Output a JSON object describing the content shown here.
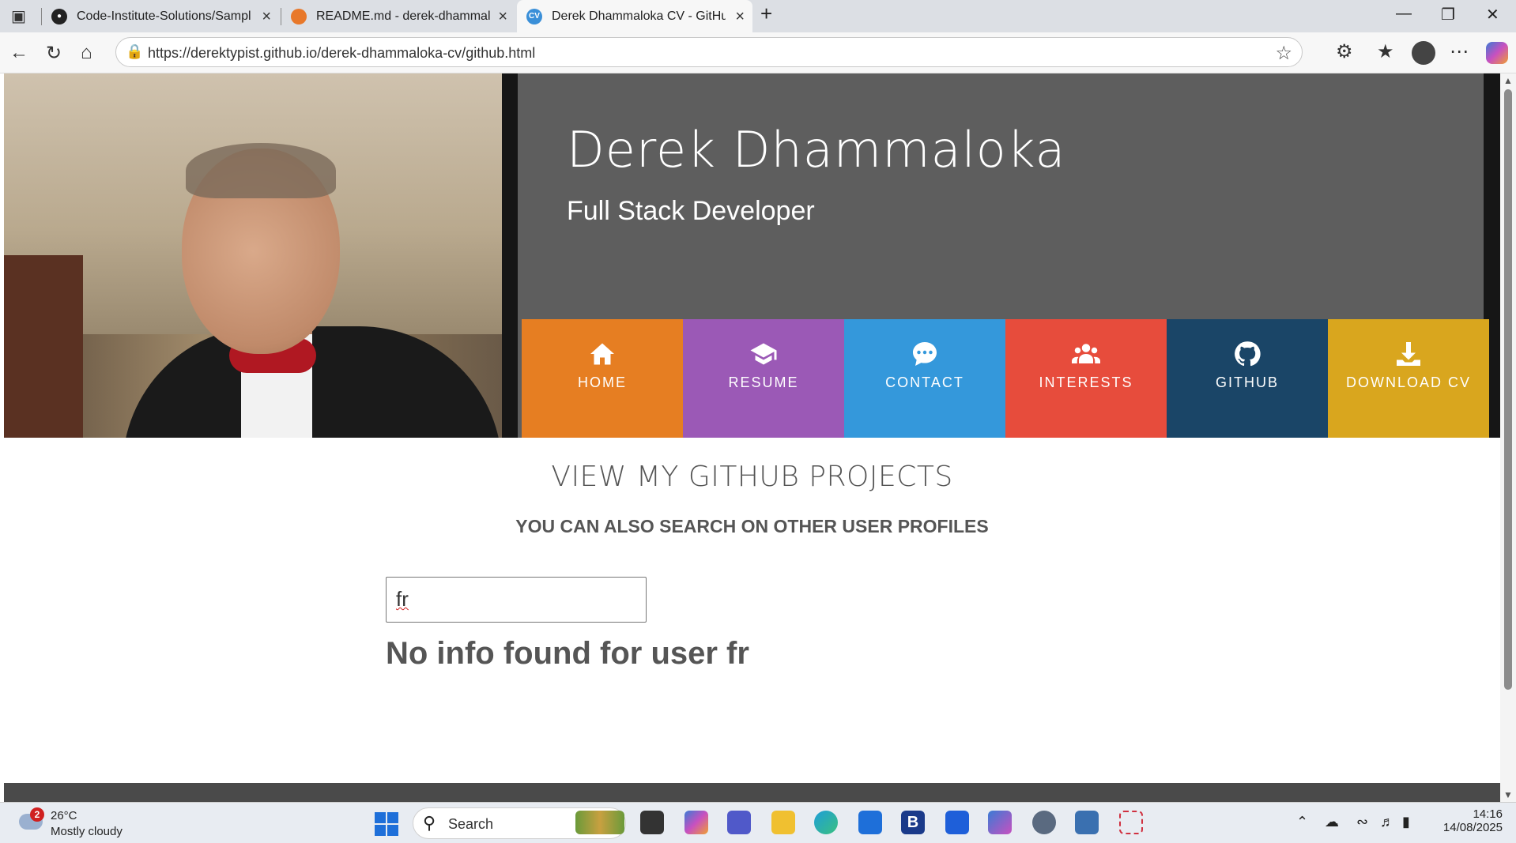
{
  "browser": {
    "tabs": [
      {
        "title": "Code-Institute-Solutions/Sample",
        "active": false
      },
      {
        "title": "README.md - derek-dhammalok",
        "active": false
      },
      {
        "title": "Derek Dhammaloka CV - GitHub",
        "active": true
      }
    ],
    "active_tab_favicon": "CV",
    "url": "https://derektypist.github.io/derek-dhammaloka-cv/github.html"
  },
  "header": {
    "name": "Derek Dhammaloka",
    "role": "Full Stack Developer"
  },
  "nav": [
    {
      "label": "HOME",
      "icon": "home-icon",
      "color": "#e67e22"
    },
    {
      "label": "RESUME",
      "icon": "graduation-cap-icon",
      "color": "#9b59b6"
    },
    {
      "label": "CONTACT",
      "icon": "chat-icon",
      "color": "#3498db"
    },
    {
      "label": "INTERESTS",
      "icon": "users-icon",
      "color": "#e74c3c"
    },
    {
      "label": "GITHUB",
      "icon": "github-icon",
      "color": "#1a4567"
    },
    {
      "label": "DOWNLOAD CV",
      "icon": "download-icon",
      "color": "#d9a61e"
    }
  ],
  "main": {
    "heading": "VIEW MY GITHUB PROJECTS",
    "subheading": "YOU CAN ALSO SEARCH ON OTHER USER PROFILES",
    "search_value": "fr",
    "result_text": "No info found for user fr"
  },
  "taskbar": {
    "weather_badge": "2",
    "weather_temp": "26°C",
    "weather_condition": "Mostly cloudy",
    "search_label": "Search",
    "time": "14:16",
    "date": "14/08/2025"
  }
}
